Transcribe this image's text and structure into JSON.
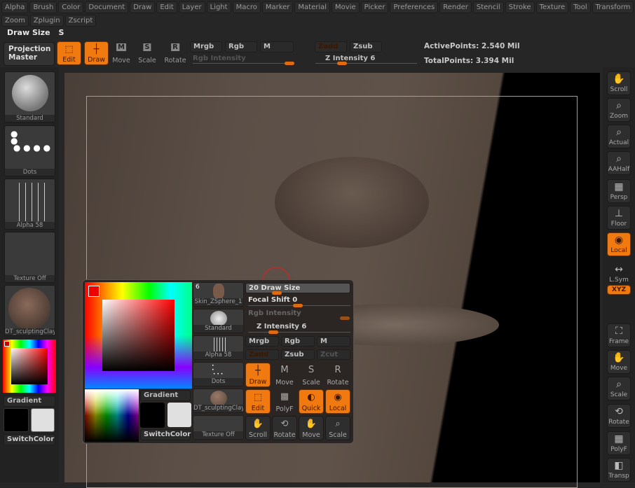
{
  "menu": {
    "row1": [
      "Alpha",
      "Brush",
      "Color",
      "Document",
      "Draw",
      "Edit",
      "Layer",
      "Light",
      "Macro",
      "Marker",
      "Material",
      "Movie",
      "Picker",
      "Preferences",
      "Render",
      "Stencil",
      "Stroke",
      "Texture",
      "Tool",
      "Transform"
    ],
    "row2": [
      "Zoom",
      "Zplugin",
      "Zscript"
    ]
  },
  "hotkey": {
    "label": "Draw Size",
    "key": "S"
  },
  "toolbar": {
    "projection_master": "Projection Master",
    "edit": "Edit",
    "draw": "Draw",
    "move": "Move",
    "scale": "Scale",
    "rotate": "Rotate",
    "mrgb": "Mrgb",
    "rgb": "Rgb",
    "m": "M",
    "rgb_intensity": "Rgb Intensity",
    "zadd": "Zadd",
    "zsub": "Zsub",
    "z_intensity": "Z Intensity 6",
    "active_points": "ActivePoints: 2.540 Mil",
    "total_points": "TotalPoints: 3.394 Mil",
    "move_key": "M",
    "scale_key": "S",
    "rotate_key": "R"
  },
  "left": {
    "brush": "Standard",
    "stroke": "Dots",
    "alpha": "Alpha 58",
    "texture": "Texture Off",
    "material": "DT_sculptingClay",
    "gradient": "Gradient",
    "switch": "SwitchColor"
  },
  "right": {
    "items": [
      "Scroll",
      "Zoom",
      "Actual",
      "AAHalf",
      "Persp",
      "Floor",
      "Local",
      "L.Sym",
      "XYZ",
      "Frame",
      "Move",
      "Scale",
      "Rotate",
      "PolyF",
      "Transp"
    ]
  },
  "popup": {
    "tool_count": "6",
    "tool": "Skin_ZSphere_1",
    "brush": "Standard",
    "alpha": "Alpha 58",
    "stroke": "Dots",
    "material": "DT_sculptingClay",
    "texture": "Texture Off",
    "gradient": "Gradient",
    "switch": "SwitchColor",
    "draw_size": "20 Draw Size",
    "focal_shift": "Focal Shift 0",
    "rgb_intensity": "Rgb Intensity",
    "z_intensity": "Z Intensity 6",
    "mrgb": "Mrgb",
    "rgb": "Rgb",
    "m": "M",
    "zadd": "Zadd",
    "zsub": "Zsub",
    "zcut": "Zcut",
    "draw": "Draw",
    "move": "Move",
    "scale": "Scale",
    "rotate": "Rotate",
    "edit": "Edit",
    "polyf": "PolyF",
    "quick": "Quick",
    "local": "Local",
    "scroll": "Scroll",
    "rotate2": "Rotate",
    "move2": "Move",
    "scale2": "Scale"
  },
  "colors": {
    "accent": "#f07a10",
    "primary_color": "#000000",
    "secondary_color": "#e0e0e0"
  }
}
